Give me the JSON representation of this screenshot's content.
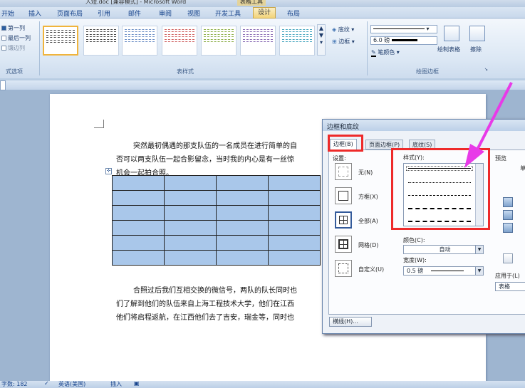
{
  "window": {
    "title": "人短.doc [兼容模式] - Microsoft Word",
    "context_tab": "表格工具"
  },
  "ribbon_tabs": [
    "开始",
    "插入",
    "页面布局",
    "引用",
    "邮件",
    "审阅",
    "视图",
    "开发工具",
    "设计",
    "布局"
  ],
  "active_tab": "设计",
  "table_style_options": {
    "items": [
      "第一列",
      "最后一列",
      "镶边列"
    ],
    "group_label": "式选项"
  },
  "table_styles": {
    "group_label": "表样式"
  },
  "shading": {
    "shading_label": "底纹",
    "border_label": "边框"
  },
  "draw_borders": {
    "pen_width": "6.0 磅",
    "pen_color_label": "笔颜色",
    "draw_table_label": "绘制表格",
    "eraser_label": "擦除",
    "group_label": "绘图边框"
  },
  "document": {
    "para1_line1": "突然最初偶遇的那支队伍的一名成员在进行简单的自",
    "para1_line2": "否可以两支队伍一起合影留念，当时我的内心是有一丝惊",
    "para1_line3": "机会一起拍合照。",
    "para2_line1": "合照过后我们互相交换的微信号，两队的队长同时也",
    "para2_line2": "们了解到他们的队伍来自上海工程技术大学，他们在江西",
    "para2_line3": "他们将启程返航，在江西他们去了吉安，瑞金等，同时也",
    "table": {
      "rows": 6,
      "cols": 4
    }
  },
  "dialog": {
    "title": "边框和底纹",
    "tabs": [
      "边框(B)",
      "页面边框(P)",
      "底纹(S)"
    ],
    "active_tab": "边框(B)",
    "settings_label": "设置:",
    "settings": [
      "无(N)",
      "方框(X)",
      "全部(A)",
      "网格(D)",
      "自定义(U)"
    ],
    "style_label": "样式(Y):",
    "color_label": "颜色(C):",
    "color_value": "自动",
    "width_label": "宽度(W):",
    "width_value": "0.5 磅",
    "preview_label": "预览",
    "preview_hint": "单",
    "apply_to_label": "应用于(L)",
    "apply_to_value": "表格",
    "horizontal_line_button": "横线(H)..."
  },
  "status_bar": {
    "word_count": "字数: 182",
    "language": "英语(美国)",
    "mode": "插入"
  },
  "colors": {
    "highlight_red": "#ee2a2a",
    "arrow_magenta": "#e83ae8",
    "table_fill": "#a9c7ea",
    "active_tab": "#f2d47a"
  }
}
